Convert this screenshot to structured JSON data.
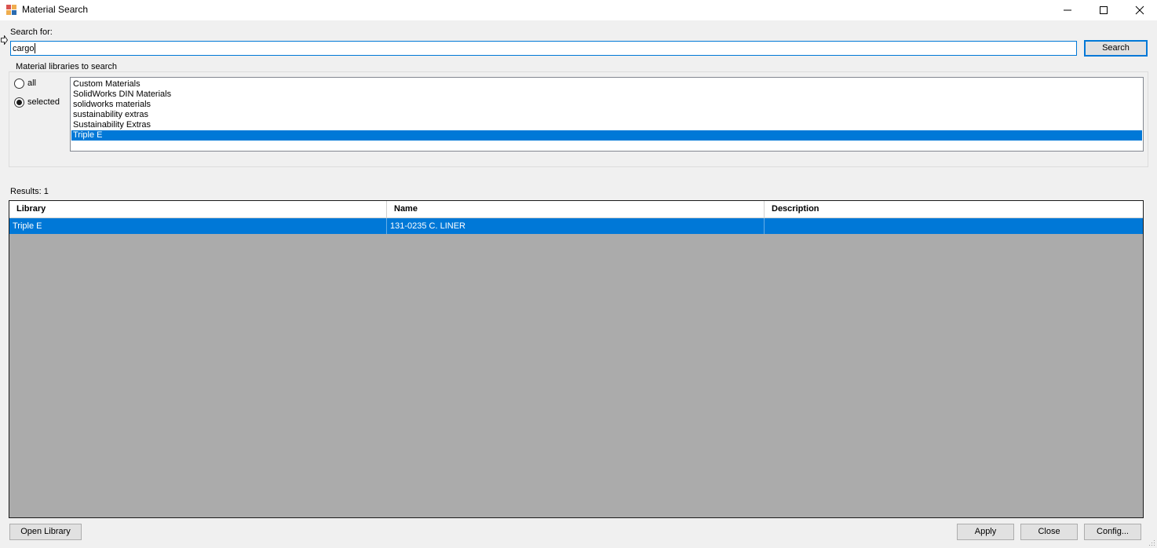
{
  "window": {
    "title": "Material Search"
  },
  "search": {
    "label": "Search for:",
    "value": "cargo",
    "button_label": "Search"
  },
  "libraries": {
    "group_label": "Material libraries to search",
    "radio_all_label": "all",
    "radio_selected_label": "selected",
    "selected_option": "selected",
    "items": [
      {
        "label": "Custom Materials",
        "selected": false
      },
      {
        "label": "SolidWorks DIN Materials",
        "selected": false
      },
      {
        "label": "solidworks materials",
        "selected": false
      },
      {
        "label": "sustainability extras",
        "selected": false
      },
      {
        "label": "Sustainability Extras",
        "selected": false
      },
      {
        "label": "Triple E",
        "selected": true
      }
    ]
  },
  "results": {
    "label": "Results: 1",
    "columns": [
      "Library",
      "Name",
      "Description"
    ],
    "rows": [
      {
        "library": "Triple E",
        "name": "131-0235 C. LINER",
        "description": ""
      }
    ]
  },
  "buttons": {
    "open_library": "Open Library",
    "apply": "Apply",
    "close": "Close",
    "config": "Config..."
  },
  "colors": {
    "accent": "#0078d7",
    "grid_background": "#ababab"
  }
}
